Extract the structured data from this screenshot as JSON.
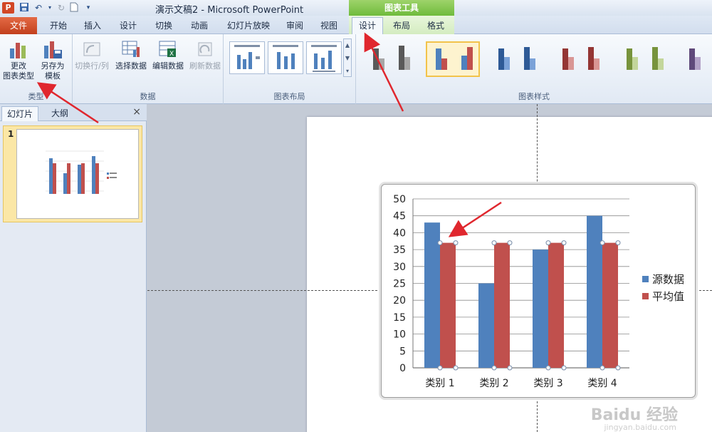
{
  "titlebar": {
    "app_logo": "P",
    "title": "演示文稿2 - Microsoft PowerPoint",
    "chart_tools": "图表工具"
  },
  "tabs": [
    "文件",
    "开始",
    "插入",
    "设计",
    "切换",
    "动画",
    "幻灯片放映",
    "审阅",
    "视图"
  ],
  "chart_tabs": [
    "设计",
    "布局",
    "格式"
  ],
  "ribbon": {
    "groups": {
      "type": "类型",
      "data": "数据",
      "layout": "图表布局",
      "styles": "图表样式"
    },
    "buttons": {
      "change_type": [
        "更改",
        "图表类型"
      ],
      "save_template": [
        "另存为",
        "模板"
      ],
      "switch_row_col": "切换行/列",
      "select_data": "选择数据",
      "edit_data": "编辑数据",
      "refresh_data": "刷新数据"
    }
  },
  "pane": {
    "tab_slides": "幻灯片",
    "tab_outline": "大纲",
    "close": "×",
    "slide_number": "1"
  },
  "colors": {
    "series1": "#4f81bd",
    "series2": "#c0504d",
    "accent_file_tab": "#d24726",
    "chart_tools_green": "#6fbb3c",
    "arrow": "#e0272e"
  },
  "chart_data": {
    "type": "bar",
    "categories": [
      "类别 1",
      "类别 2",
      "类别 3",
      "类别 4"
    ],
    "series": [
      {
        "name": "源数据",
        "values": [
          43,
          25,
          35,
          45
        ]
      },
      {
        "name": "平均值",
        "values": [
          37,
          37,
          37,
          37
        ]
      }
    ],
    "ylim": [
      0,
      50
    ],
    "yticks": [
      0,
      5,
      10,
      15,
      20,
      25,
      30,
      35,
      40,
      45,
      50
    ],
    "grid": true,
    "legend": "right"
  },
  "watermark": {
    "text": "Baidu 经验",
    "url": "jingyan.baidu.com"
  }
}
